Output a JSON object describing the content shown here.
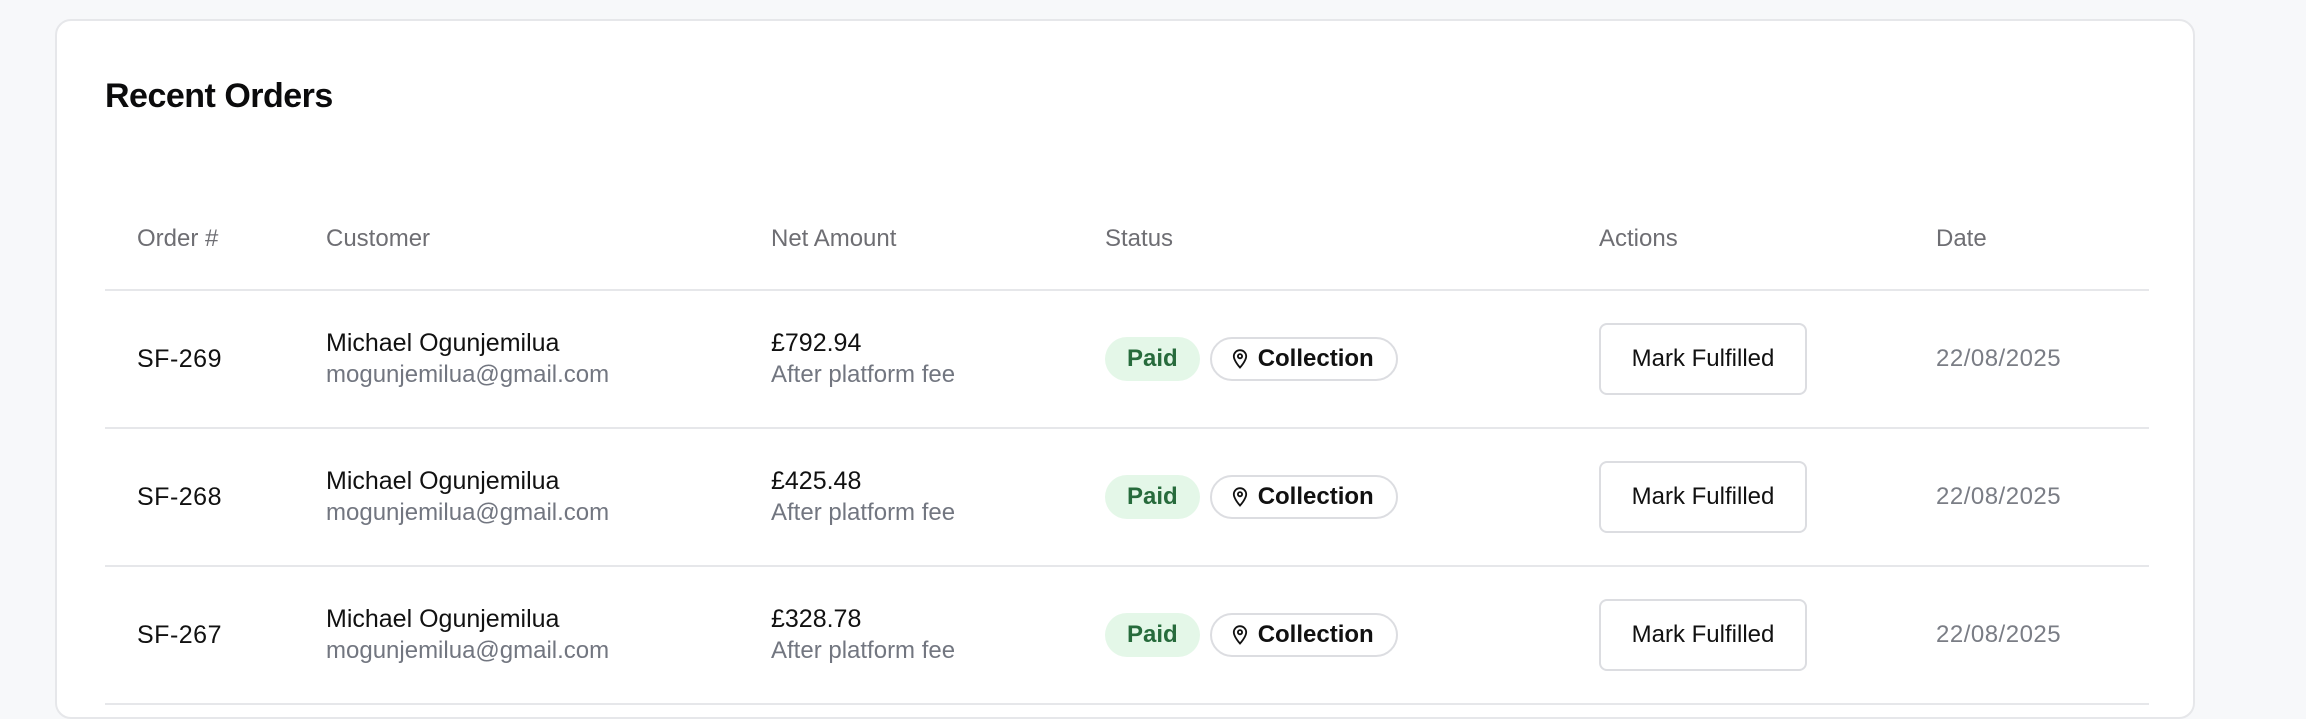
{
  "page": {
    "title": "Recent Orders"
  },
  "table": {
    "headers": {
      "order": "Order #",
      "customer": "Customer",
      "net_amount": "Net Amount",
      "status": "Status",
      "actions": "Actions",
      "date": "Date"
    },
    "rows": [
      {
        "order_id": "SF-269",
        "customer_name": "Michael Ogunjemilua",
        "customer_email": "mogunjemilua@gmail.com",
        "amount": "£792.94",
        "amount_note": "After platform fee",
        "payment_status": "Paid",
        "fulfillment_type": "Collection",
        "action_label": "Mark Fulfilled",
        "date": "22/08/2025"
      },
      {
        "order_id": "SF-268",
        "customer_name": "Michael Ogunjemilua",
        "customer_email": "mogunjemilua@gmail.com",
        "amount": "£425.48",
        "amount_note": "After platform fee",
        "payment_status": "Paid",
        "fulfillment_type": "Collection",
        "action_label": "Mark Fulfilled",
        "date": "22/08/2025"
      },
      {
        "order_id": "SF-267",
        "customer_name": "Michael Ogunjemilua",
        "customer_email": "mogunjemilua@gmail.com",
        "amount": "£328.78",
        "amount_note": "After platform fee",
        "payment_status": "Paid",
        "fulfillment_type": "Collection",
        "action_label": "Mark Fulfilled",
        "date": "22/08/2025"
      }
    ]
  },
  "icons": {
    "collection": "map-pin-icon"
  },
  "colors": {
    "paid_bg": "#e4f7e8",
    "paid_text": "#276b3c",
    "border": "#e6e7ea"
  }
}
